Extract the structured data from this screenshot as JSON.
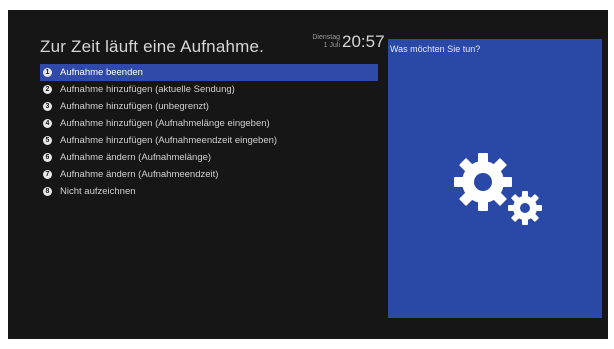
{
  "screen": {
    "title": "Zur Zeit läuft eine Aufnahme.",
    "clock": {
      "day": "Dienstag",
      "date": "1 Juli",
      "time": "20:57"
    }
  },
  "menu": {
    "selected_index": 0,
    "items": [
      {
        "number": "1",
        "label": "Aufnahme beenden"
      },
      {
        "number": "2",
        "label": "Aufnahme hinzufügen (aktuelle Sendung)"
      },
      {
        "number": "3",
        "label": "Aufnahme hinzufügen (unbegrenzt)"
      },
      {
        "number": "4",
        "label": "Aufnahme hinzufügen (Aufnahmelänge eingeben)"
      },
      {
        "number": "5",
        "label": "Aufnahme hinzufügen (Aufnahmeendzeit eingeben)"
      },
      {
        "number": "6",
        "label": "Aufnahme ändern (Aufnahmelänge)"
      },
      {
        "number": "7",
        "label": "Aufnahme ändern (Aufnahmeendzeit)"
      },
      {
        "number": "8",
        "label": "Nicht aufzeichnen"
      }
    ]
  },
  "panel": {
    "prompt": "Was möchten Sie tun?",
    "icon": "gears-icon"
  },
  "colors": {
    "background": "#161616",
    "selection": "#2f4aa8",
    "panel": "#2a48a6",
    "text": "#d0d0d0"
  }
}
